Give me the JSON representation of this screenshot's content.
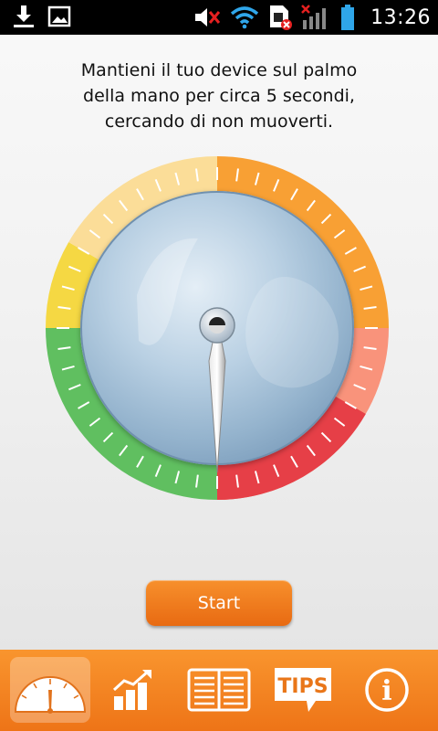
{
  "status_bar": {
    "time": "13:26",
    "left_icons": [
      "download-icon",
      "image-icon"
    ],
    "right_icons": [
      "volume-muted-icon",
      "wifi-icon",
      "sim-error-icon",
      "signal-no-service-icon",
      "battery-icon"
    ]
  },
  "instruction": {
    "line1": "Mantieni il tuo device sul palmo",
    "line2": "della mano per circa 5 secondi,",
    "line3": "cercando di non muoverti."
  },
  "gauge": {
    "needle_value": 0.5,
    "colors": {
      "yellow": "#f4d32a",
      "light_yellow": "#fbd98a",
      "orange": "#f79319",
      "salmon": "#f98569",
      "red": "#e3252e",
      "green": "#4bb74a",
      "dial": "#a9c4dc"
    }
  },
  "start_button": {
    "label": "Start"
  },
  "bottom_nav": {
    "accent": "#f28020",
    "items": [
      {
        "icon": "gauge-icon",
        "active": true
      },
      {
        "icon": "chart-icon",
        "active": false
      },
      {
        "icon": "book-icon",
        "active": false
      },
      {
        "icon": "tips-icon",
        "label": "TIPS",
        "active": false
      },
      {
        "icon": "info-icon",
        "label": "i",
        "active": false
      }
    ]
  }
}
